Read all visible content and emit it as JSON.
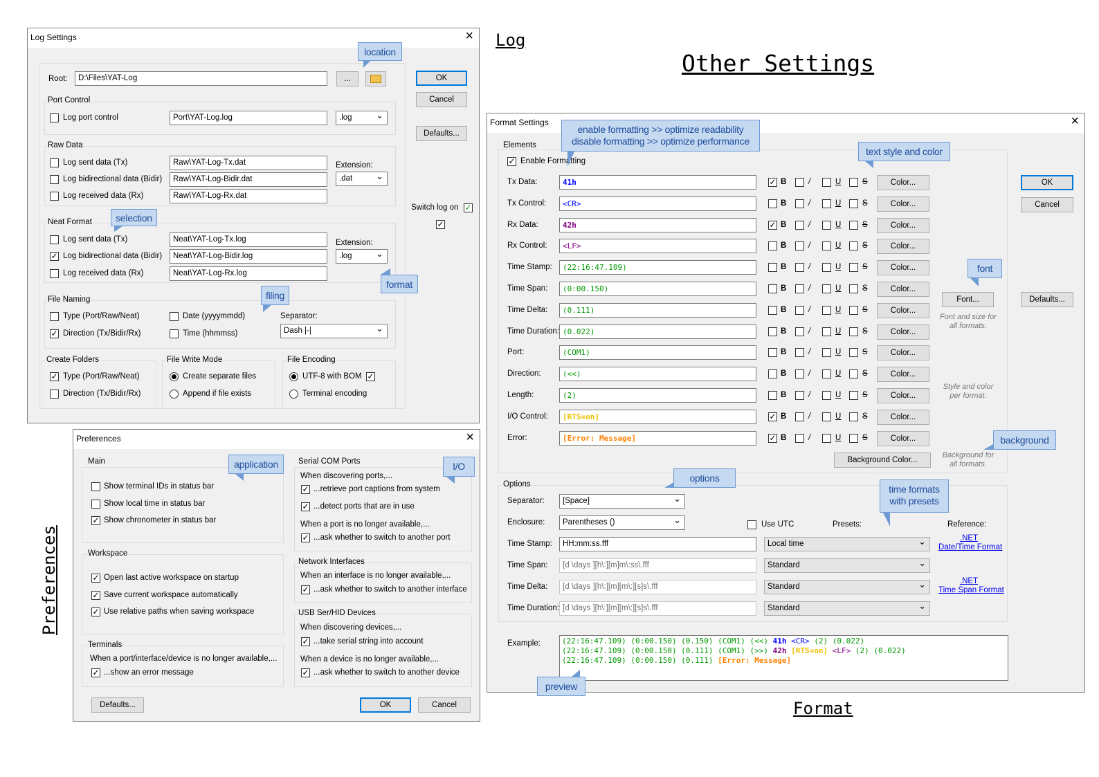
{
  "page_titles": {
    "log": "Log",
    "other": "Other Settings",
    "format": "Format",
    "preferences": "Preferences"
  },
  "log": {
    "title": "Log Settings",
    "root_label": "Root:",
    "root_value": "D:\\Files\\YAT-Log",
    "browse": "...",
    "ok": "OK",
    "cancel": "Cancel",
    "defaults": "Defaults...",
    "port_control": "Port Control",
    "log_port_control": "Log port control",
    "port_file": "Port\\YAT-Log.log",
    "port_ext": ".log",
    "raw_data": "Raw Data",
    "extension": "Extension:",
    "tx": "Log sent data (Tx)",
    "bidir": "Log bidirectional data (Bidir)",
    "rx": "Log received data (Rx)",
    "raw_tx": "Raw\\YAT-Log-Tx.dat",
    "raw_bidir": "Raw\\YAT-Log-Bidir.dat",
    "raw_rx": "Raw\\YAT-Log-Rx.dat",
    "raw_ext": ".dat",
    "neat_format": "Neat Format",
    "neat_tx": "Neat\\YAT-Log-Tx.log",
    "neat_bidir": "Neat\\YAT-Log-Bidir.log",
    "neat_rx": "Neat\\YAT-Log-Rx.log",
    "neat_ext": ".log",
    "switch_log_on": "Switch log on",
    "file_naming": "File Naming",
    "type": "Type (Port/Raw/Neat)",
    "direction": "Direction (Tx/Bidir/Rx)",
    "date": "Date (yyyymmdd)",
    "time": "Time (hhmmss)",
    "separator": "Separator:",
    "separator_value": "Dash |-|",
    "create_folders": "Create Folders",
    "file_write_mode": "File Write Mode",
    "create_separate": "Create separate files",
    "append": "Append if file exists",
    "file_encoding": "File Encoding",
    "utf8": "UTF-8 with BOM",
    "terminal_enc": "Terminal encoding"
  },
  "pref": {
    "title": "Preferences",
    "main": "Main",
    "show_ids": "Show terminal IDs in status bar",
    "show_local": "Show local time in status bar",
    "show_chrono": "Show chronometer in status bar",
    "workspace": "Workspace",
    "open_last": "Open last active workspace on startup",
    "save_ws": "Save current workspace automatically",
    "rel_paths": "Use relative paths when saving workspace",
    "terminals": "Terminals",
    "term_line": "When a port/interface/device is no longer available,...",
    "show_err": "...show an error message",
    "serial": "Serial COM Ports",
    "discover_ports": "When discovering ports,...",
    "retrieve": "...retrieve port captions from system",
    "detect": "...detect ports that are in use",
    "port_gone": "When a port is no longer available,...",
    "ask_port": "...ask whether to switch to another port",
    "network": "Network Interfaces",
    "iface_gone": "When an interface is no longer available,...",
    "ask_iface": "...ask whether to switch to another interface",
    "usb": "USB Ser/HID Devices",
    "discover_dev": "When discovering devices,...",
    "serial_str": "...take serial string into account",
    "dev_gone": "When a device is no longer available,...",
    "ask_dev": "...ask whether to switch to another device",
    "defaults": "Defaults...",
    "ok": "OK",
    "cancel": "Cancel"
  },
  "fmt": {
    "title": "Format Settings",
    "elements": "Elements",
    "enable": "Enable Formatting",
    "color_btn": "Color...",
    "style_b": "B",
    "style_i": "/",
    "style_u": "U",
    "style_s": "S",
    "rows": [
      {
        "label": "Tx Data:",
        "value": "41h",
        "color": "#0000ff",
        "bold": true
      },
      {
        "label": "Tx Control:",
        "value": "<CR>",
        "color": "#0000ff",
        "bold": false
      },
      {
        "label": "Rx Data:",
        "value": "42h",
        "color": "#800080",
        "bold": true
      },
      {
        "label": "Rx Control:",
        "value": "<LF>",
        "color": "#800080",
        "bold": false
      },
      {
        "label": "Time Stamp:",
        "value": "(22:16:47.109)",
        "color": "#009900",
        "bold": false
      },
      {
        "label": "Time Span:",
        "value": "(0:00.150)",
        "color": "#009900",
        "bold": false
      },
      {
        "label": "Time Delta:",
        "value": "(0.111)",
        "color": "#009900",
        "bold": false
      },
      {
        "label": "Time Duration:",
        "value": "(0.022)",
        "color": "#009900",
        "bold": false
      },
      {
        "label": "Port:",
        "value": "(COM1)",
        "color": "#009900",
        "bold": false
      },
      {
        "label": "Direction:",
        "value": "(<<)",
        "color": "#009900",
        "bold": false
      },
      {
        "label": "Length:",
        "value": "(2)",
        "color": "#009900",
        "bold": false
      },
      {
        "label": "I/O Control:",
        "value": "[RTS=on]",
        "color": "#f0c000",
        "bold": true
      },
      {
        "label": "Error:",
        "value": "[Error: Message]",
        "color": "#ff8000",
        "bold": true
      }
    ],
    "font_btn": "Font...",
    "font_note": "Font and size for all formats.",
    "style_note": "Style and color per format.",
    "bg_btn": "Background Color...",
    "bg_note": "Background for all formats.",
    "ok": "OK",
    "cancel": "Cancel",
    "defaults": "Defaults...",
    "options": "Options",
    "separator": "Separator:",
    "separator_value": "[Space]",
    "enclosure": "Enclosure:",
    "enclosure_value": "Parentheses ()",
    "use_utc": "Use UTC",
    "presets": "Presets:",
    "reference": "Reference:",
    "ts_label": "Time Stamp:",
    "ts_value": "HH:mm:ss.fff",
    "ts_preset": "Local time",
    "tspan_label": "Time Span:",
    "tspan_value": "[d \\days ][h\\:][m]m\\:ss\\.fff",
    "tspan_preset": "Standard",
    "tdelta_label": "Time Delta:",
    "tdelta_value": "[d \\days ][h\\:][m][m\\:][s]s\\.fff",
    "tdelta_preset": "Standard",
    "tdur_label": "Time Duration:",
    "tdur_value": "[d \\days ][h\\:][m][m\\:][s]s\\.fff",
    "tdur_preset": "Standard",
    "net1": ".NET",
    "net1b": "Date/Time Format",
    "net2": ".NET",
    "net2b": "Time Span Format",
    "example": "Example:",
    "ex_l1a": "(22:16:47.109) (0:00.150) (0.150) (COM1) (<<) ",
    "ex_l1b": "41h",
    "ex_l1c": " <CR>",
    "ex_l1d": " (2) (0.022)",
    "ex_l2a": "(22:16:47.109) (0:00.150) (0.111) (COM1) (>>) ",
    "ex_l2b": "42h",
    "ex_l2c": " [RTS=on]",
    "ex_l2d": " <LF>",
    "ex_l2e": " (2) (0.022)",
    "ex_l3a": "(22:16:47.109) (0:00.150) (0.111) ",
    "ex_l3b": "[Error: Message]"
  },
  "callouts": {
    "location": "location",
    "selection": "selection",
    "format": "format",
    "filing": "filing",
    "application": "application",
    "io": "I/O",
    "enable1": "enable formatting >> optimize readability",
    "enable2": "disable formatting >> optimize performance",
    "textstyle": "text style and color",
    "font": "font",
    "background": "background",
    "options": "options",
    "timefmt1": "time formats",
    "timefmt2": "with presets",
    "preview": "preview"
  },
  "colors": {
    "callout_bg": "#c5d9f1",
    "callout_border": "#6f9bd4",
    "callout_text": "#1f4e9c",
    "accent": "#0078d7"
  }
}
